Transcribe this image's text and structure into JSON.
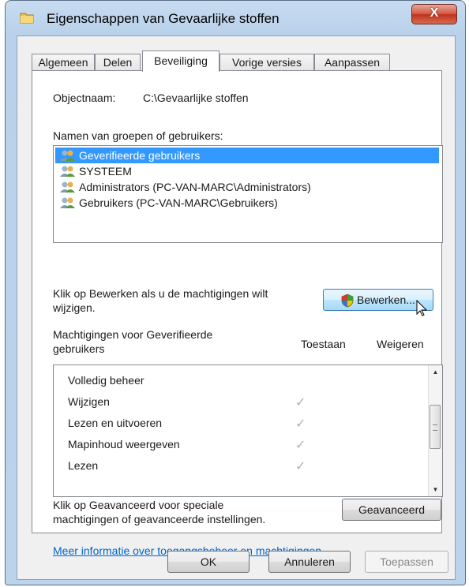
{
  "window": {
    "title": "Eigenschappen van Gevaarlijke stoffen",
    "close_label": "X"
  },
  "tabs": [
    {
      "label": "Algemeen"
    },
    {
      "label": "Delen"
    },
    {
      "label": "Beveiliging"
    },
    {
      "label": "Vorige versies"
    },
    {
      "label": "Aanpassen"
    }
  ],
  "object": {
    "label": "Objectnaam:",
    "value": "C:\\Gevaarlijke stoffen"
  },
  "groups": {
    "label": "Namen van groepen of gebruikers:",
    "items": [
      "Geverifieerde gebruikers",
      "SYSTEEM",
      "Administrators (PC-VAN-MARC\\Administrators)",
      "Gebruikers (PC-VAN-MARC\\Gebruikers)"
    ],
    "selected_index": 0
  },
  "edit": {
    "text_line1": "Klik op Bewerken als u de machtigingen wilt",
    "text_line2": "wijzigen.",
    "button_label": "Bewerken..."
  },
  "permissions": {
    "title_line1": "Machtigingen voor Geverifieerde",
    "title_line2": "gebruikers",
    "col_allow": "Toestaan",
    "col_deny": "Weigeren",
    "rows": [
      {
        "name": "Volledig beheer",
        "allow": false
      },
      {
        "name": "Wijzigen",
        "allow": true
      },
      {
        "name": "Lezen en uitvoeren",
        "allow": true
      },
      {
        "name": "Mapinhoud weergeven",
        "allow": true
      },
      {
        "name": "Lezen",
        "allow": true
      }
    ]
  },
  "advanced": {
    "text_line1": "Klik op Geavanceerd voor speciale",
    "text_line2": "machtigingen of geavanceerde instellingen.",
    "button_label": "Geavanceerd"
  },
  "help_link": "Meer informatie over toegangsbeheer en machtigingen",
  "footer": {
    "ok": "OK",
    "cancel": "Annuleren",
    "apply": "Toepassen"
  },
  "colors": {
    "selection": "#3399ff",
    "link": "#0066cc",
    "close": "#c0321c"
  },
  "icons": [
    "folder-icon",
    "users-icon",
    "shield-icon",
    "cursor-icon"
  ]
}
